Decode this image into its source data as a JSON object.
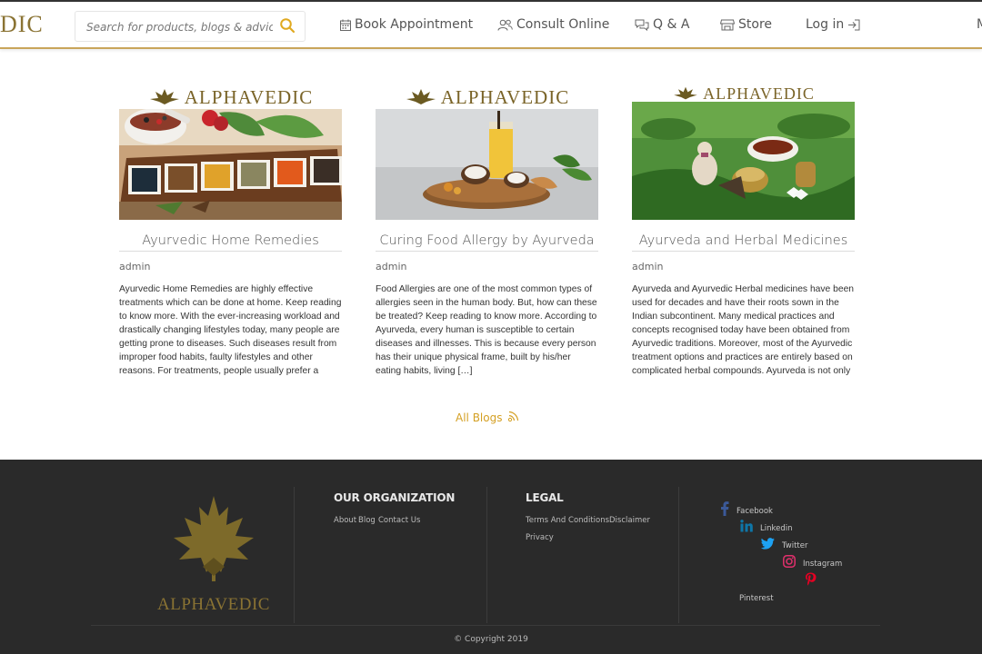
{
  "header": {
    "logo_text": "DIC",
    "search_placeholder": "Search for products, blogs & advices",
    "nav": [
      {
        "label": "Book Appointment",
        "icon": "calendar-icon"
      },
      {
        "label": "Consult Online",
        "icon": "users-icon"
      },
      {
        "label": "Q & A",
        "icon": "chat-icon"
      },
      {
        "label": "Store",
        "icon": "store-icon"
      },
      {
        "label": "Log in",
        "icon": "login-icon"
      }
    ],
    "nav_overflow": "M"
  },
  "brand": "ALPHAVEDIC",
  "blogs": [
    {
      "title": "Ayurvedic Home Remedies",
      "author": "admin",
      "excerpt": "Ayurvedic Home Remedies are highly effective treatments which can be done at home. Keep reading to know more. With the ever-increasing workload and drastically changing lifestyles today, many people are getting prone to diseases. Such diseases result from improper food habits, faulty lifestyles and other reasons. For treatments, people usually prefer a physician or an […]"
    },
    {
      "title": "Curing Food Allergy by Ayurveda",
      "author": "admin",
      "excerpt": "Food Allergies are one of the most common types of allergies seen in the human body. But, how can these be treated? Keep reading to know more. According to Ayurveda, every human is susceptible to certain diseases and illnesses. This is because every person has their unique physical frame, built by his/her eating habits, living […]"
    },
    {
      "title": "Ayurveda and Herbal Medicines",
      "author": "admin",
      "excerpt": "Ayurveda and Ayurvedic Herbal medicines have been used for decades and have their roots sown in the Indian subcontinent. Many medical practices and concepts recognised today have been obtained from Ayurvedic traditions. Moreover, most of the Ayurvedic treatment options and practices are entirely based on complicated herbal compounds. Ayurveda is not only prevalent in India, […]"
    }
  ],
  "all_blogs_label": "All Blogs",
  "footer": {
    "brand": "ALPHAVEDIC",
    "org_heading": "OUR ORGANIZATION",
    "org_links": [
      "About",
      "Blog",
      "Contact Us"
    ],
    "legal_heading": "LEGAL",
    "legal_links": [
      "Terms And Conditions",
      "Disclaimer",
      "Privacy"
    ],
    "social": [
      {
        "label": "Facebook",
        "icon": "facebook-icon",
        "color": "#3b5998"
      },
      {
        "label": "Linkedin",
        "icon": "linkedin-icon",
        "color": "#0e76a8"
      },
      {
        "label": "Twitter",
        "icon": "twitter-icon",
        "color": "#1da1f2"
      },
      {
        "label": "Instagram",
        "icon": "instagram-icon",
        "color": "#e1306c"
      },
      {
        "label": "Pinterest",
        "icon": "pinterest-icon",
        "color": "#e60023"
      }
    ],
    "copyright": "© Copyright 2019"
  },
  "colors": {
    "accent": "#d4a024",
    "brand_gold": "#8a7333",
    "footer_bg": "#2a2a2a"
  }
}
